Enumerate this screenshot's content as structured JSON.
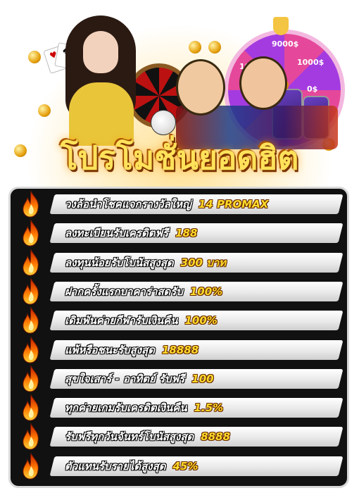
{
  "banner": {
    "title": "โปรโมชั่นยอดฮิต",
    "wheel_labels": [
      "9000$",
      "1000$",
      "0$",
      "1000$"
    ]
  },
  "colors": {
    "accent_yellow": "#ffdc2a",
    "panel_bg": "#111111",
    "row_bar": "#ffffff",
    "flame": "#ff5a00"
  },
  "promotions": [
    {
      "text": "วงล้อนำโชคแจกรางวัลใหญ่",
      "highlight": "14 PROMAX",
      "icon": "flame-icon"
    },
    {
      "text": "ลงทะเบียนรับเครดิตฟรี",
      "highlight": "188",
      "icon": "flame-icon"
    },
    {
      "text": "ลงทุนน้อยรับโบนัสสูงสุด",
      "highlight": "300 บาท",
      "icon": "flame-icon"
    },
    {
      "text": "ฝากครั้งแรกบาคาร่าสดรับ",
      "highlight": "100%",
      "icon": "flame-icon"
    },
    {
      "text": "เดิมพันค่ายกีฬารับเงินคืน",
      "highlight": "100%",
      "icon": "flame-icon"
    },
    {
      "text": "แพ้หรือชนะรับสูงสุด",
      "highlight": "18888",
      "icon": "flame-icon"
    },
    {
      "text": "สุขใจเสาร์ - อาทิตย์ รับฟรี",
      "highlight": "100",
      "icon": "flame-icon"
    },
    {
      "text": "ทุกค่ายเกมรับเครดิตเงินคืน",
      "highlight": "1.5%",
      "icon": "flame-icon"
    },
    {
      "text": "รับฟรีทุกวันจันทร์โบนัสสูงสุด",
      "highlight": "8888",
      "icon": "flame-icon"
    },
    {
      "text": "ตัวแทนรับรายได้สูงสุด",
      "highlight": "45%",
      "icon": "flame-icon"
    }
  ]
}
